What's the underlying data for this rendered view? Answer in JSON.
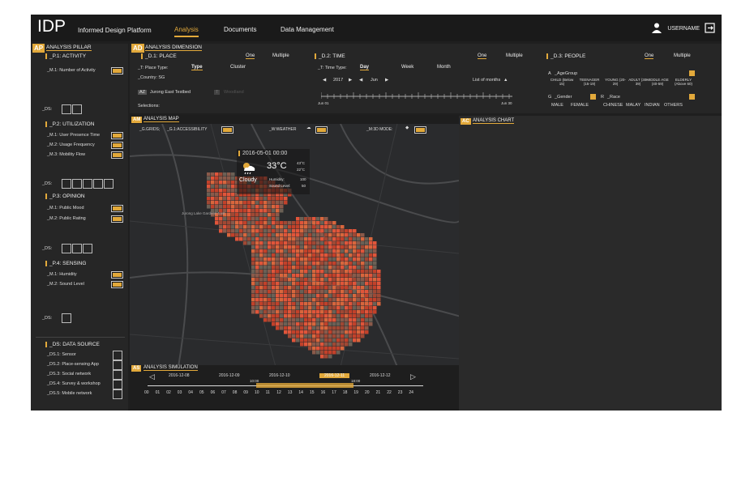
{
  "app": {
    "title": "IDP",
    "subtitle": "Informed Design Platform",
    "username": "USERNAME"
  },
  "nav": {
    "items": [
      "Analysis",
      "Documents",
      "Data Management"
    ]
  },
  "pillar": {
    "tag": "AP",
    "title": "ANALYSIS PILLAR",
    "activity": {
      "title": "_P.1: ACTIVITY",
      "m1": "_M.1: Number of Activity",
      "ds": "_DS:"
    },
    "utilization": {
      "title": "_P.2: UTILIZATION",
      "m1": "_M.1: User Presence Time",
      "m2": "_M.2: Usage Frequency",
      "m3": "_M.3: Mobility Flow",
      "ds": "_DS:"
    },
    "opinion": {
      "title": "_P.3: OPINION",
      "m1": "_M.1: Public Mood",
      "m2": "_M.2: Public Rating",
      "ds": "_DS:"
    },
    "sensing": {
      "title": "_P.4: SENSING",
      "m1": "_M.1: Humidity",
      "m2": "_M.2: Sound Level",
      "ds": "_DS:"
    },
    "datasource": {
      "title": "_DS: DATA SOURCE",
      "items": [
        "_DS.1: Sensor",
        "_DS.2: Place-sensing App",
        "_DS.3: Social network",
        "_DS.4: Survey & workshop",
        "_DS.5: Mobile network"
      ]
    }
  },
  "dimension": {
    "tag": "AD",
    "title": "ANALYSIS DIMENSION",
    "place": {
      "title": "_D.1: PLACE",
      "one": "One",
      "multiple": "Multiple",
      "type_label": "_T: Place Type:",
      "type": "Type",
      "cluster": "Cluster",
      "country": "_Country: SG",
      "region_code": "AZ",
      "region": "Jurong East Testbed",
      "region2_code": "T",
      "region2": "Woodland",
      "selections": "Selections:"
    },
    "time": {
      "title": "_D.2: TIME",
      "one": "One",
      "multiple": "Multiple",
      "type_label": "_T: Time Type:",
      "day": "Day",
      "week": "Week",
      "month": "Month",
      "year": "2017",
      "month_sel": "Jun",
      "list": "List of months",
      "start": "Jun 01",
      "end": "Jun 30"
    },
    "people": {
      "title": "_D.3: PEOPLE",
      "one": "One",
      "multiple": "Multiple",
      "age_code": "A",
      "age_label": "_AgeGroup",
      "ages": [
        "CHILD (Below 15)",
        "TEENAGER (15-19)",
        "YOUNG (20-29)",
        "ADULT (30-39)",
        "MIDDLE AGE (40-59)",
        "ELDERLY (Above 60)"
      ],
      "gender_code": "G",
      "gender_label": "_Gender",
      "race_code": "R",
      "race_label": "_Race",
      "genders": [
        "MALE",
        "FEMALE"
      ],
      "races": [
        "CHINESE",
        "MALAY",
        "INDIAN",
        "OTHERS"
      ]
    }
  },
  "map": {
    "tag": "AM",
    "title": "ANALYSIS MAP",
    "grids": "_G.GRIDS;",
    "access": "_G.1:ACCESSIBILITY",
    "weather": "_W:WEATHER",
    "mode": "_M:3D MODE:",
    "date": "2016-05-01  00:00",
    "temp": "33°C",
    "hi": "43°C",
    "lo": "22°C",
    "condition": "Cloudy",
    "humidity_label": "Humidity:",
    "humidity": "100",
    "sound_label": "Sound Level:",
    "sound": "50",
    "place1": "Jurong Lake Gardens East"
  },
  "chart": {
    "tag": "AC",
    "title": "ANALYSIS CHART"
  },
  "simulation": {
    "tag": "AS",
    "title": "ANALYSIS SIMULATION",
    "dates": [
      "2016-12-08",
      "2016-12-09",
      "2016-12-10",
      "2016-12-11",
      "2016-12-12"
    ],
    "active_date": "2016-12-11",
    "hours": [
      "00",
      "01",
      "02",
      "03",
      "04",
      "05",
      "06",
      "07",
      "08",
      "09",
      "10",
      "11",
      "12",
      "13",
      "14",
      "15",
      "16",
      "17",
      "18",
      "19",
      "20",
      "21",
      "22",
      "23",
      "24"
    ],
    "start_time": "10:00",
    "end_time": "18:00"
  },
  "colors": {
    "accent": "#e2a93b",
    "bg": "#1f1f1f",
    "panel": "#262626"
  }
}
